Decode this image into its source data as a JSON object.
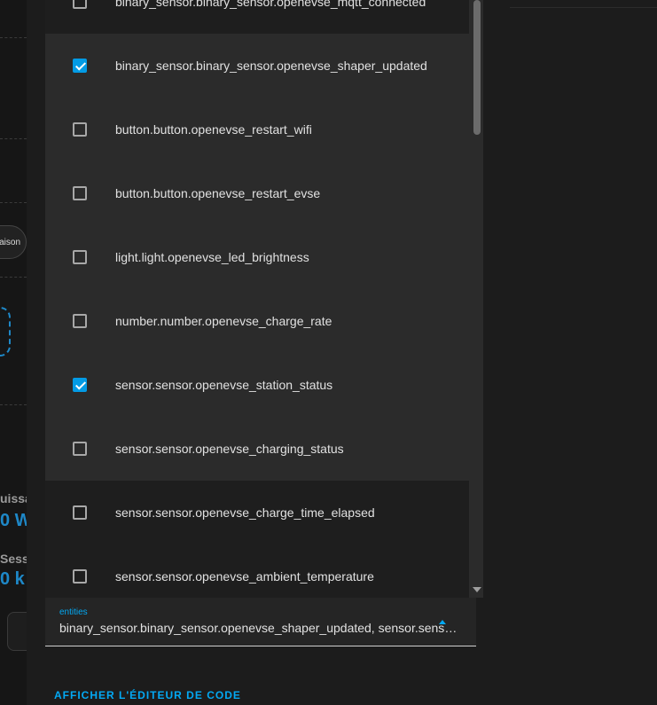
{
  "background": {
    "chip_label": "aison",
    "puissance_label": "uissa",
    "puissance_value": "0 W",
    "session_label": "Sessi",
    "session_value": "0 k"
  },
  "dropdown": {
    "options": [
      {
        "label": "binary_sensor.binary_sensor.openevse_mqtt_connected",
        "checked": false
      },
      {
        "label": "binary_sensor.binary_sensor.openevse_shaper_updated",
        "checked": true
      },
      {
        "label": "button.button.openevse_restart_wifi",
        "checked": false
      },
      {
        "label": "button.button.openevse_restart_evse",
        "checked": false
      },
      {
        "label": "light.light.openevse_led_brightness",
        "checked": false
      },
      {
        "label": "number.number.openevse_charge_rate",
        "checked": false
      },
      {
        "label": "sensor.sensor.openevse_station_status",
        "checked": true
      },
      {
        "label": "sensor.sensor.openevse_charging_status",
        "checked": false
      },
      {
        "label": "sensor.sensor.openevse_charge_time_elapsed",
        "checked": false
      },
      {
        "label": "sensor.sensor.openevse_ambient_temperature",
        "checked": false
      }
    ]
  },
  "entities_field": {
    "label": "entities",
    "value": "binary_sensor.binary_sensor.openevse_shaper_updated, sensor.sensor.openevse_station_status"
  },
  "code_editor_label": "AFFICHER L'ÉDITEUR DE CODE",
  "colors": {
    "accent": "#03a9f4",
    "checkbox_checked": "#039be5"
  }
}
